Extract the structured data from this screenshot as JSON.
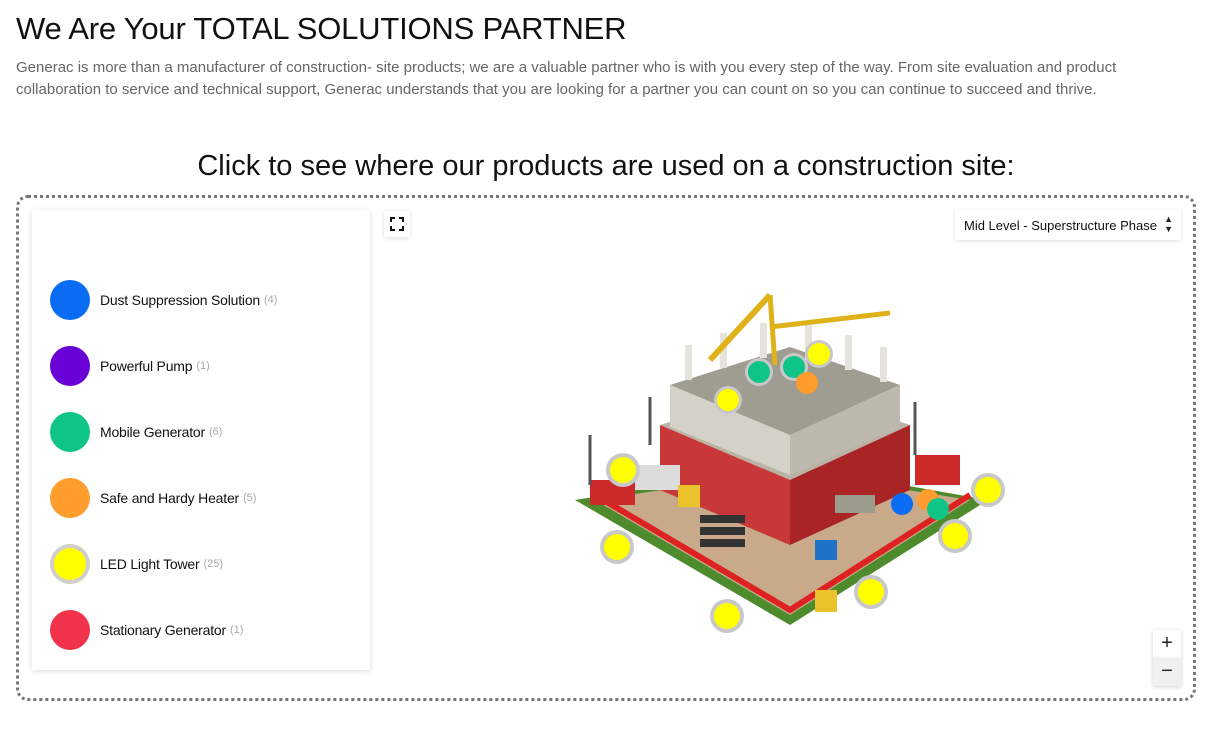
{
  "header": {
    "title": "We Are Your TOTAL SOLUTIONS PARTNER",
    "intro": "Generac is more than a manufacturer of construction- site products; we are a valuable partner who is with you every step of the way. From site evaluation and product collaboration to service and technical support, Generac understands that you are looking for a partner you can count on so you can continue to succeed and thrive."
  },
  "map": {
    "cta": "Click to see where our products are used on a construction site:",
    "phase_selected": "Mid Level - Superstructure Phase",
    "zoom_in_label": "+",
    "zoom_out_label": "−",
    "legend": [
      {
        "label": "Dust Suppression Solution",
        "count": "(4)",
        "color": "#0a6cf2"
      },
      {
        "label": "Powerful Pump",
        "count": "(1)",
        "color": "#6a00d8"
      },
      {
        "label": "Mobile Generator",
        "count": "(6)",
        "color": "#0ec487"
      },
      {
        "label": "Safe and Hardy Heater",
        "count": "(5)",
        "color": "#ff9d2e"
      },
      {
        "label": "LED Light Tower",
        "count": "(25)",
        "color": "#ffff00",
        "ring": "#cfcfcf"
      },
      {
        "label": "Stationary Generator",
        "count": "(1)",
        "color": "#f0334a"
      }
    ]
  },
  "icons": {
    "fullscreen": "fullscreen-icon",
    "select_arrows": "up-down-arrows-icon"
  }
}
